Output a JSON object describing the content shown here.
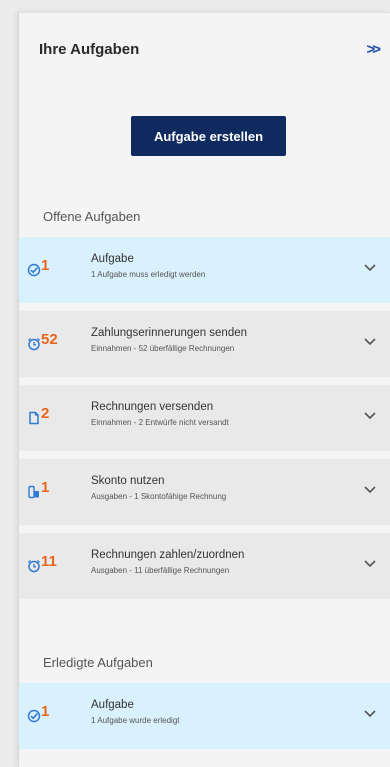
{
  "header": {
    "title": "Ihre Aufgaben",
    "collapse_label": ">>"
  },
  "create_button": "Aufgabe erstellen",
  "sections": {
    "open_label": "Offene Aufgaben",
    "done_label": "Erledigte Aufgaben"
  },
  "open_tasks": [
    {
      "icon": "check-icon",
      "count": "1",
      "title": "Aufgabe",
      "subtitle": "1 Aufgabe muss erledigt werden"
    },
    {
      "icon": "alarm-clock-icon",
      "count": "52",
      "title": "Zahlungserinnerungen senden",
      "subtitle": "Einnahmen - 52 überfällige Rechnungen"
    },
    {
      "icon": "document-icon",
      "count": "2",
      "title": "Rechnungen versenden",
      "subtitle": "Einnahmen - 2 Entwürfe nicht versandt"
    },
    {
      "icon": "discount-icon",
      "count": "1",
      "title": "Skonto nutzen",
      "subtitle": "Ausgaben - 1 Skontofähige Rechnung"
    },
    {
      "icon": "alarm-clock-icon",
      "count": "11",
      "title": "Rechnungen zahlen/zuordnen",
      "subtitle": "Ausgaben - 11 überfällige Rechnungen"
    }
  ],
  "done_tasks": [
    {
      "icon": "check-icon",
      "count": "1",
      "title": "Aufgabe",
      "subtitle": "1 Aufgabe wurde erledigt"
    }
  ],
  "colors": {
    "accent_blue": "#1f4ea8",
    "button_navy": "#0f2a5e",
    "count_orange": "#e8651b",
    "highlight_bg": "#d9f1fc"
  }
}
